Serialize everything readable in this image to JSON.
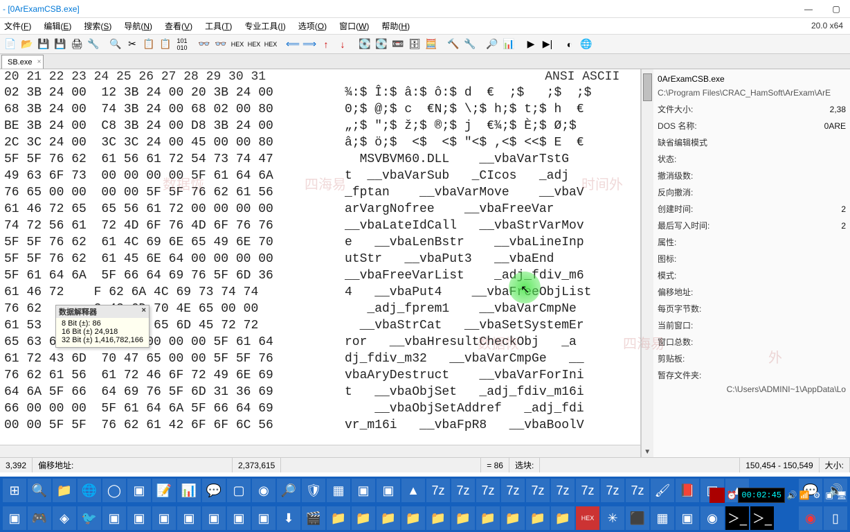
{
  "title": "- [0ArExamCSB.exe]",
  "version": "20.0 x64",
  "menu": [
    {
      "label": "文件",
      "key": "F"
    },
    {
      "label": "编辑",
      "key": "E"
    },
    {
      "label": "搜索",
      "key": "S"
    },
    {
      "label": "导航",
      "key": "N"
    },
    {
      "label": "查看",
      "key": "V"
    },
    {
      "label": "工具",
      "key": "T"
    },
    {
      "label": "专业工具",
      "key": "I"
    },
    {
      "label": "选项",
      "key": "O"
    },
    {
      "label": "窗口",
      "key": "W"
    },
    {
      "label": "帮助",
      "key": "H"
    }
  ],
  "tabname": "SB.exe",
  "ruler_hex": "20 21 22 23  24 25 26 27 28 29 30 31",
  "ruler_ascii": "ANSI ASCII",
  "hexlines": [
    {
      "b": "02 3B 24 00  12 3B 24 00 20 3B 24 00",
      "a": "¾:$ Î:$ â:$ ô:$ d  €  ;$   ;$  ;$"
    },
    {
      "b": "68 3B 24 00  74 3B 24 00 68 02 00 80",
      "a": "0;$ @;$ c  €N;$ \\;$ h;$ t;$ h  €"
    },
    {
      "b": "BE 3B 24 00  C8 3B 24 00 D8 3B 24 00",
      "a": "„;$ \";$ ž;$ ®;$ j  €¾;$ È;$ Ø;$"
    },
    {
      "b": "2C 3C 24 00  3C 3C 24 00 45 00 00 80",
      "a": "â;$ ö;$  <$  <$ \"<$ ,<$ <<$ E  €"
    },
    {
      "b": "5F 5F 76 62  61 56 61 72 54 73 74 47",
      "a": "  MSVBVM60.DLL    __vbaVarTstG"
    },
    {
      "b": "49 63 6F 73  00 00 00 00 5F 61 64 6A",
      "a": "t  __vbaVarSub   _CIcos   _adj"
    },
    {
      "b": "76 65 00 00  00 00 5F 5F 76 62 61 56",
      "a": "_fptan    __vbaVarMove    __vbaV"
    },
    {
      "b": "61 46 72 65  65 56 61 72 00 00 00 00",
      "a": "arVargNofree    __vbaFreeVar"
    },
    {
      "b": "74 72 56 61  72 4D 6F 76 4D 6F 76 76",
      "a": "__vbaLateIdCall   __vbaStrVarMov"
    },
    {
      "b": "5F 5F 76 62  61 4C 69 6E 65 49 6E 70",
      "a": "e   __vbaLenBstr    __vbaLineInp"
    },
    {
      "b": "5F 5F 76 62  61 45 6E 64 00 00 00 00",
      "a": "utStr   __vbaPut3   __vbaEnd"
    },
    {
      "b": "5F 61 64 6A  5F 66 64 69 76 5F 6D 36",
      "a": "__vbaFreeVarList    _adj_fdiv_m6"
    },
    {
      "b": "61 46 72    F 62 6A 4C 69 73 74 74",
      "a": "4   __vbaPut4    __vbaFreeObjList"
    },
    {
      "b": "76 62       2 43 6D 70 4E 65 00 00",
      "a": "   _adj_fprem1    __vbaVarCmpNe"
    },
    {
      "b": "61 53       9 73 74 65 6D 45 72 72",
      "a": "  __vbaStrCat   __vbaSetSystemEr"
    },
    {
      "b": "65 63 6B 4F  1A 00 00 00 00 5F 61 64",
      "a": "ror   __vbaHresultCheckObj   _a"
    },
    {
      "b": "61 72 43 6D  70 47 65 00 00 5F 5F 76",
      "a": "dj_fdiv_m32   __vbaVarCmpGe   __"
    },
    {
      "b": "76 62 61 56  61 72 46 6F 72 49 6E 69",
      "a": "vbaAryDestruct    __vbaVarForIni"
    },
    {
      "b": "64 6A 5F 66  64 69 76 5F 6D 31 36 69",
      "a": "t   __vbaObjSet   _adj_fdiv_m16i"
    },
    {
      "b": "66 00 00 00  5F 61 64 6A 5F 66 64 69",
      "a": "    __vbaObjSetAddref   _adj_fdi"
    },
    {
      "b": "00 00 5F 5F  76 62 61 42 6F 6F 6C 56",
      "a": "vr_m16i   __vbaFpR8   __vbaBoolV"
    }
  ],
  "tooltip": {
    "title": "数据解释器",
    "l1": "8 Bit (±): 86",
    "l2": "16 Bit (±) 24,918",
    "l3": "32 Bit (±) 1,416,782,166"
  },
  "sidebar": {
    "filename": "0ArExamCSB.exe",
    "path": "C:\\Program Files\\CRAC_HamSoft\\ArExam\\ArE",
    "filesize_lbl": "文件大小:",
    "filesize_val": "2,38",
    "dosname_lbl": "DOS 名称:",
    "dosname_val": "0ARE",
    "defenc_lbl": "缺省编辑模式",
    "state_lbl": "状态:",
    "undo_lbl": "撤消级数:",
    "undo_val": "",
    "redo_lbl": "反向撤消:",
    "redo_val": "",
    "ctime_lbl": "创建时间:",
    "ctime_val": "2",
    "mtime_lbl": "最后写入时间:",
    "mtime_val": "2",
    "attr_lbl": "属性:",
    "icon_lbl": "图标:",
    "mode_lbl": "模式:",
    "offaddr_lbl": "偏移地址:",
    "bpp_lbl": "每页字节数:",
    "curwin_lbl": "当前窗口:",
    "wincnt_lbl": "窗口总数:",
    "clip_lbl": "剪贴板:",
    "tmp_lbl": "暂存文件夹:",
    "tmp_val": "C:\\Users\\ADMINI~1\\AppData\\Lo"
  },
  "status": {
    "bytes": "3,392",
    "offset_lbl": "偏移地址:",
    "offset": "2,373,615",
    "eq": "= 86",
    "sel_lbl": "选块:",
    "range": "150,454 - 150,549",
    "size_lbl": "大小:"
  },
  "clock": "00:02:45"
}
